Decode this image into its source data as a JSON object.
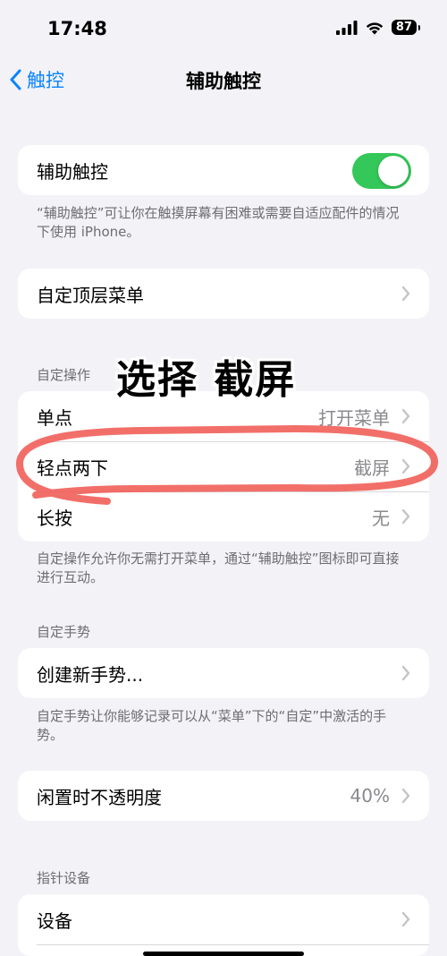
{
  "status_bar": {
    "time": "17:48",
    "battery": "87"
  },
  "nav": {
    "back_label": "触控",
    "title": "辅助触控"
  },
  "assistive_touch": {
    "label": "辅助触控",
    "enabled": true,
    "footer": "“辅助触控”可让你在触摸屏幕有困难或需要自适应配件的情况下使用 iPhone。"
  },
  "customize_top_menu": {
    "label": "自定顶层菜单"
  },
  "custom_actions": {
    "header": "自定操作",
    "rows": [
      {
        "label": "单点",
        "value": "打开菜单"
      },
      {
        "label": "轻点两下",
        "value": "截屏"
      },
      {
        "label": "长按",
        "value": "无"
      }
    ],
    "footer": "自定操作允许你无需打开菜单，通过“辅助触控”图标即可直接进行互动。"
  },
  "custom_gestures": {
    "header": "自定手势",
    "create_label": "创建新手势...",
    "footer": "自定手势让你能够记录可以从“菜单”下的“自定”中激活的手势。"
  },
  "idle_opacity": {
    "label": "闲置时不透明度",
    "value": "40%"
  },
  "pointer_devices": {
    "header": "指针设备",
    "devices_label": "设备"
  },
  "annotation": {
    "text": "选择 截屏",
    "highlight_color": "#f0564f"
  },
  "colors": {
    "accent": "#0a84ff",
    "toggle_on": "#34c759",
    "background": "#f2f2f7"
  }
}
